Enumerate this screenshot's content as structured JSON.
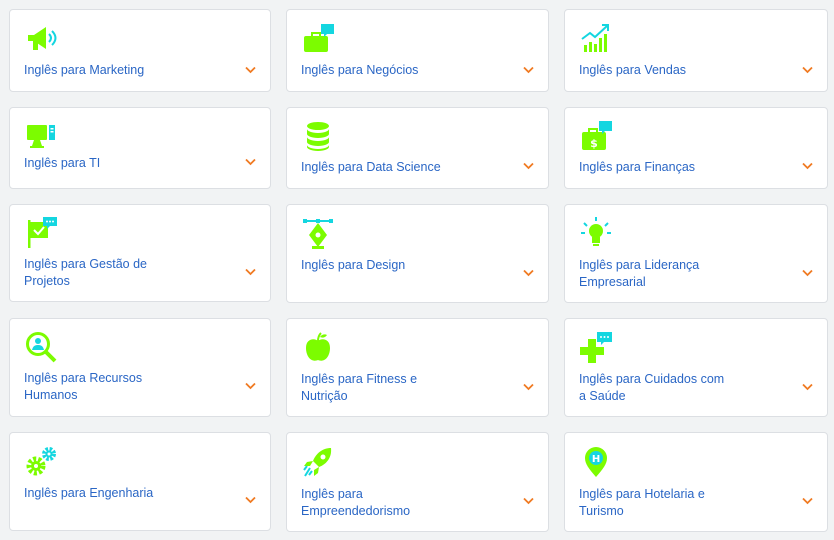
{
  "colors": {
    "green": "#7cfc00",
    "cyan": "#14d6e0",
    "link": "#2a66c5",
    "chevron": "#f07a22"
  },
  "courses": [
    {
      "label": "Inglês para Marketing",
      "icon": "megaphone-icon"
    },
    {
      "label": "Inglês para Negócios",
      "icon": "briefcase-chat-icon"
    },
    {
      "label": "Inglês para Vendas",
      "icon": "growth-chart-icon"
    },
    {
      "label": "Inglês para TI",
      "icon": "computer-icon"
    },
    {
      "label": "Inglês para Data Science",
      "icon": "database-icon"
    },
    {
      "label": "Inglês para Finanças",
      "icon": "money-bag-icon"
    },
    {
      "label": "Inglês para Gestão de Projetos",
      "icon": "project-flag-icon"
    },
    {
      "label": "Inglês para Design",
      "icon": "pen-tool-icon"
    },
    {
      "label": "Inglês para Liderança Empresarial",
      "icon": "lightbulb-icon"
    },
    {
      "label": "Inglês para Recursos Humanos",
      "icon": "person-search-icon"
    },
    {
      "label": "Inglês para Fitness e Nutrição",
      "icon": "apple-icon"
    },
    {
      "label": "Inglês para Cuidados com a Saúde",
      "icon": "health-cross-chat-icon"
    },
    {
      "label": "Inglês para Engenharia",
      "icon": "gears-icon"
    },
    {
      "label": "Inglês para Empreendedorismo",
      "icon": "rocket-icon"
    },
    {
      "label": "Inglês para Hotelaria e Turismo",
      "icon": "hotel-pin-icon"
    }
  ]
}
